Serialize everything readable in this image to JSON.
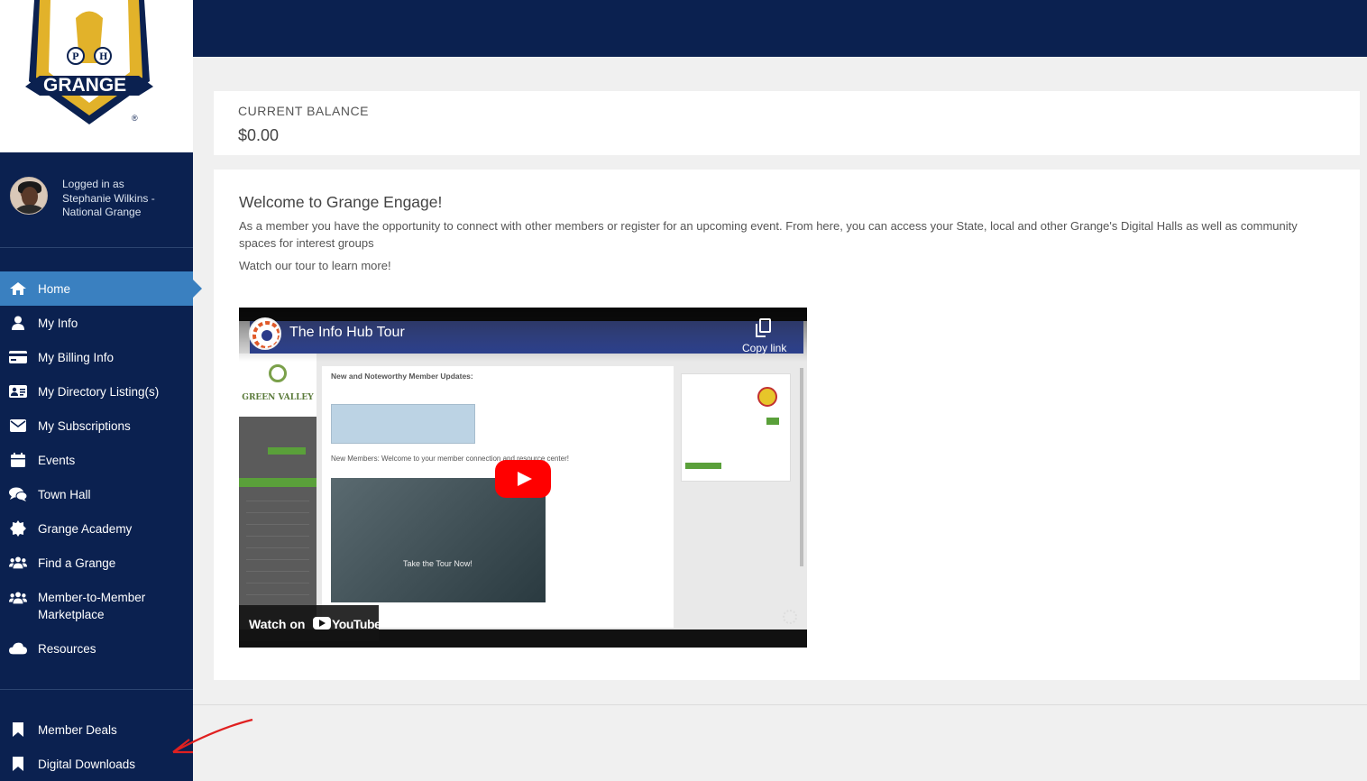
{
  "logo": {
    "brand_text": "GRANGE",
    "monogram": "P of H",
    "registered": "®"
  },
  "user": {
    "logged_in_label": "Logged in as",
    "name": "Stephanie Wilkins -",
    "org": "National Grange"
  },
  "nav": {
    "items": [
      {
        "label": "Home",
        "icon": "home-icon",
        "active": true
      },
      {
        "label": "My Info",
        "icon": "user-icon"
      },
      {
        "label": "My Billing Info",
        "icon": "credit-card-icon"
      },
      {
        "label": "My Directory Listing(s)",
        "icon": "id-card-icon"
      },
      {
        "label": "My Subscriptions",
        "icon": "envelope-icon"
      },
      {
        "label": "Events",
        "icon": "calendar-icon"
      },
      {
        "label": "Town Hall",
        "icon": "comments-icon"
      },
      {
        "label": "Grange Academy",
        "icon": "certificate-icon"
      },
      {
        "label": "Find a Grange",
        "icon": "users-icon"
      },
      {
        "label": "Member-to-Member Marketplace",
        "icon": "users-icon"
      },
      {
        "label": "Resources",
        "icon": "cloud-icon"
      }
    ],
    "secondary": [
      {
        "label": "Member Deals",
        "icon": "bookmark-icon"
      },
      {
        "label": "Digital Downloads",
        "icon": "bookmark-icon"
      }
    ]
  },
  "balance": {
    "label": "CURRENT BALANCE",
    "value": "$0.00"
  },
  "welcome": {
    "title": "Welcome to Grange Engage!",
    "text": "As a member you have the opportunity to connect with other members or register for an upcoming event. From here, you can access your State, local and other Grange's Digital Halls as well as community spaces for interest groups",
    "tour_text": "Watch our tour to learn more!"
  },
  "video": {
    "title": "The Info Hub Tour",
    "copy_link": "Copy link",
    "watch_on": "Watch on",
    "youtube": "YouTube",
    "inner_heading": "New and Noteworthy Member Updates:",
    "inner_subheading": "New Members: Welcome to your member connection and resource center!",
    "inner_video_text": "Take the Tour Now!",
    "inner_logo": "GREEN VALLEY"
  },
  "colors": {
    "navy": "#0b2150",
    "active": "#3a80c0",
    "play_red": "#ff0000",
    "annotation_arrow": "#e02020"
  }
}
